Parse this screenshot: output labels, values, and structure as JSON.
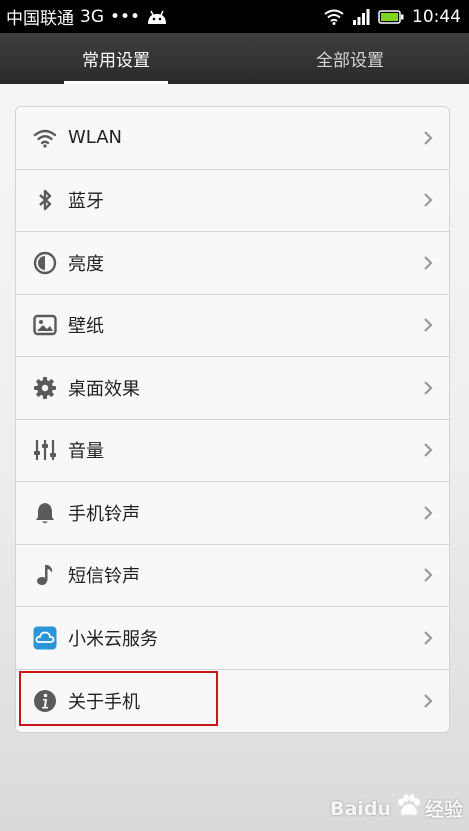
{
  "status_bar": {
    "carrier": "中国联通",
    "network": "3G",
    "dots": "•••",
    "time": "10:44"
  },
  "tabs": [
    {
      "label": "常用设置",
      "active": true
    },
    {
      "label": "全部设置",
      "active": false
    }
  ],
  "settings": [
    {
      "label": "WLAN",
      "icon": "wifi-icon"
    },
    {
      "label": "蓝牙",
      "icon": "bluetooth-icon"
    },
    {
      "label": "亮度",
      "icon": "brightness-icon"
    },
    {
      "label": "壁纸",
      "icon": "wallpaper-icon"
    },
    {
      "label": "桌面效果",
      "icon": "gear-icon"
    },
    {
      "label": "音量",
      "icon": "volume-sliders-icon"
    },
    {
      "label": "手机铃声",
      "icon": "bell-icon"
    },
    {
      "label": "短信铃声",
      "icon": "music-note-icon"
    },
    {
      "label": "小米云服务",
      "icon": "cloud-icon"
    },
    {
      "label": "关于手机",
      "icon": "info-icon"
    }
  ],
  "highlighted_item": "关于手机",
  "colors": {
    "highlight": "#c8161d",
    "icon": "#5a5a5a",
    "cloud_icon": "#2a96d8",
    "battery": "#7ed321"
  },
  "watermark": {
    "brand": "Baidu",
    "suffix": "经验"
  }
}
